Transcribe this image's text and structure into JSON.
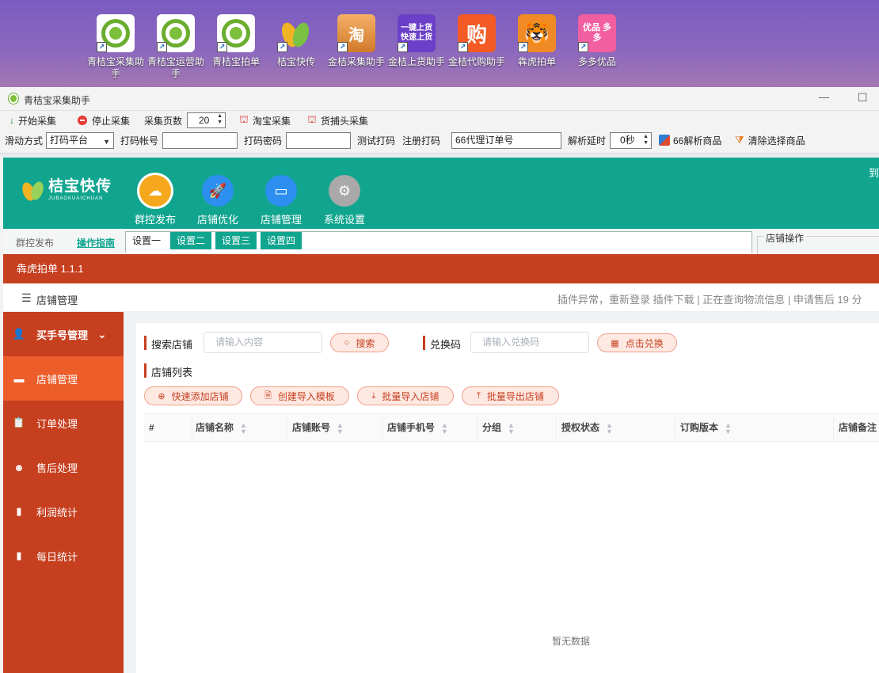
{
  "desktop": {
    "icons": [
      {
        "label": "青桔宝采集助手",
        "kind": "lemon"
      },
      {
        "label": "青桔宝运营助手",
        "kind": "lemon"
      },
      {
        "label": "青桔宝拍单",
        "kind": "lemon"
      },
      {
        "label": "桔宝快传",
        "kind": "leaf"
      },
      {
        "label": "金桔采集助手",
        "kind": "tao",
        "glyph": "淘"
      },
      {
        "label": "金桔上货助手",
        "kind": "purple",
        "glyph": "一键上货 快速上货"
      },
      {
        "label": "金桔代购助手",
        "kind": "gou",
        "glyph": "购"
      },
      {
        "label": "犇虎拍单",
        "kind": "tiger",
        "glyph": "🐯"
      },
      {
        "label": "多多优品",
        "kind": "pink",
        "glyph": "优品 多多"
      }
    ]
  },
  "window": {
    "title": "青桔宝采集助手",
    "minimize": "—",
    "maximize": "☐"
  },
  "toolbar": {
    "start": "开始采集",
    "stop": "停止采集",
    "pages_label": "采集页数",
    "pages_value": "20",
    "taobao": "淘宝采集",
    "huobutou": "货捕头采集",
    "slide_label": "滑动方式",
    "slide_value": "打码平台",
    "account_label": "打码帐号",
    "password_label": "打码密码",
    "test": "测试打码",
    "register": "注册打码",
    "order_value": "66代理订单号",
    "delay_label": "解析延时",
    "delay_value": "0秒",
    "parse": "66解析商品",
    "clear": "清除选择商品"
  },
  "brand": {
    "name": "桔宝快传",
    "sub": "JUBAOKUAICHUAN",
    "right_text": "到"
  },
  "nav": [
    {
      "label": "群控发布",
      "color": "#f5a81c"
    },
    {
      "label": "店铺优化",
      "color": "#2c8ff0"
    },
    {
      "label": "店铺管理",
      "color": "#2c8ff0"
    },
    {
      "label": "系统设置",
      "color": "#9e9e9e"
    }
  ],
  "subrow": {
    "left": "群控发布",
    "guide": "操作指南",
    "tabs": [
      "设置一",
      "设置二",
      "设置三",
      "设置四"
    ],
    "shop_ops": "店铺操作"
  },
  "banner": {
    "title": "犇虎拍单 1.1.1"
  },
  "crumb": {
    "label": "店铺管理",
    "notice": "插件异常，重新登录 插件下载 | 正在查询物流信息 | 申请售后 19 分"
  },
  "sidebar": [
    {
      "label": "买手号管理",
      "icon": "user",
      "arrow": "⌄"
    },
    {
      "label": "店铺管理",
      "icon": "store"
    },
    {
      "label": "订单处理",
      "icon": "clipboard"
    },
    {
      "label": "售后处理",
      "icon": "service"
    },
    {
      "label": "利润统计",
      "icon": "bar-chart"
    },
    {
      "label": "每日统计",
      "icon": "bar-chart"
    }
  ],
  "main": {
    "search_label": "搜索店铺",
    "search_placeholder": "请输入内容",
    "search_btn": "搜索",
    "code_label": "兑换码",
    "code_placeholder": "请输入兑换码",
    "code_btn": "点击兑换",
    "list_label": "店铺列表",
    "actions": [
      "快速添加店铺",
      "创建导入模板",
      "批量导入店铺",
      "批量导出店铺"
    ],
    "columns": [
      "#",
      "店铺名称",
      "店铺账号",
      "店铺手机号",
      "分组",
      "授权状态",
      "订购版本",
      "店铺备注"
    ],
    "empty": "暂无数据"
  }
}
